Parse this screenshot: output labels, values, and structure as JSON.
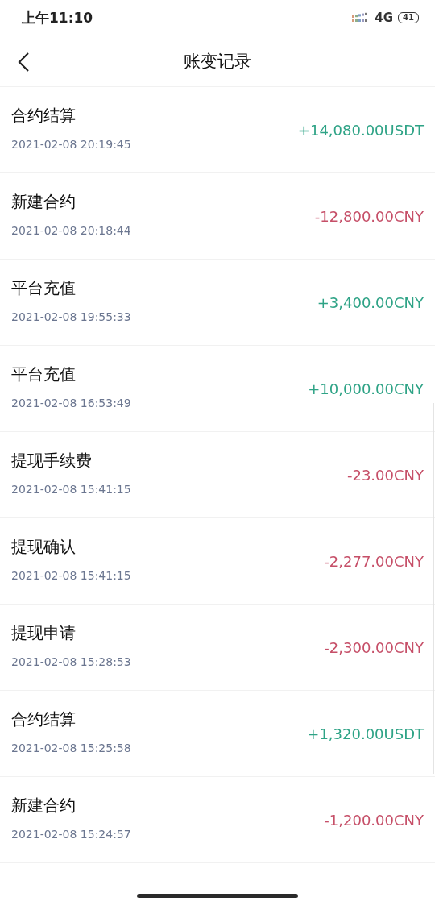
{
  "status_bar": {
    "time": "上午11:10",
    "network": "4G",
    "battery": "41"
  },
  "header": {
    "title": "账变记录"
  },
  "records": [
    {
      "title": "合约结算",
      "time": "2021-02-08 20:19:45",
      "amount": "+14,080.00USDT",
      "kind": "credit"
    },
    {
      "title": "新建合约",
      "time": "2021-02-08 20:18:44",
      "amount": "-12,800.00CNY",
      "kind": "debit"
    },
    {
      "title": "平台充值",
      "time": "2021-02-08 19:55:33",
      "amount": "+3,400.00CNY",
      "kind": "credit"
    },
    {
      "title": "平台充值",
      "time": "2021-02-08 16:53:49",
      "amount": "+10,000.00CNY",
      "kind": "credit"
    },
    {
      "title": "提现手续费",
      "time": "2021-02-08 15:41:15",
      "amount": "-23.00CNY",
      "kind": "debit"
    },
    {
      "title": "提现确认",
      "time": "2021-02-08 15:41:15",
      "amount": "-2,277.00CNY",
      "kind": "debit"
    },
    {
      "title": "提现申请",
      "time": "2021-02-08 15:28:53",
      "amount": "-2,300.00CNY",
      "kind": "debit"
    },
    {
      "title": "合约结算",
      "time": "2021-02-08 15:25:58",
      "amount": "+1,320.00USDT",
      "kind": "credit"
    },
    {
      "title": "新建合约",
      "time": "2021-02-08 15:24:57",
      "amount": "-1,200.00CNY",
      "kind": "debit"
    }
  ]
}
